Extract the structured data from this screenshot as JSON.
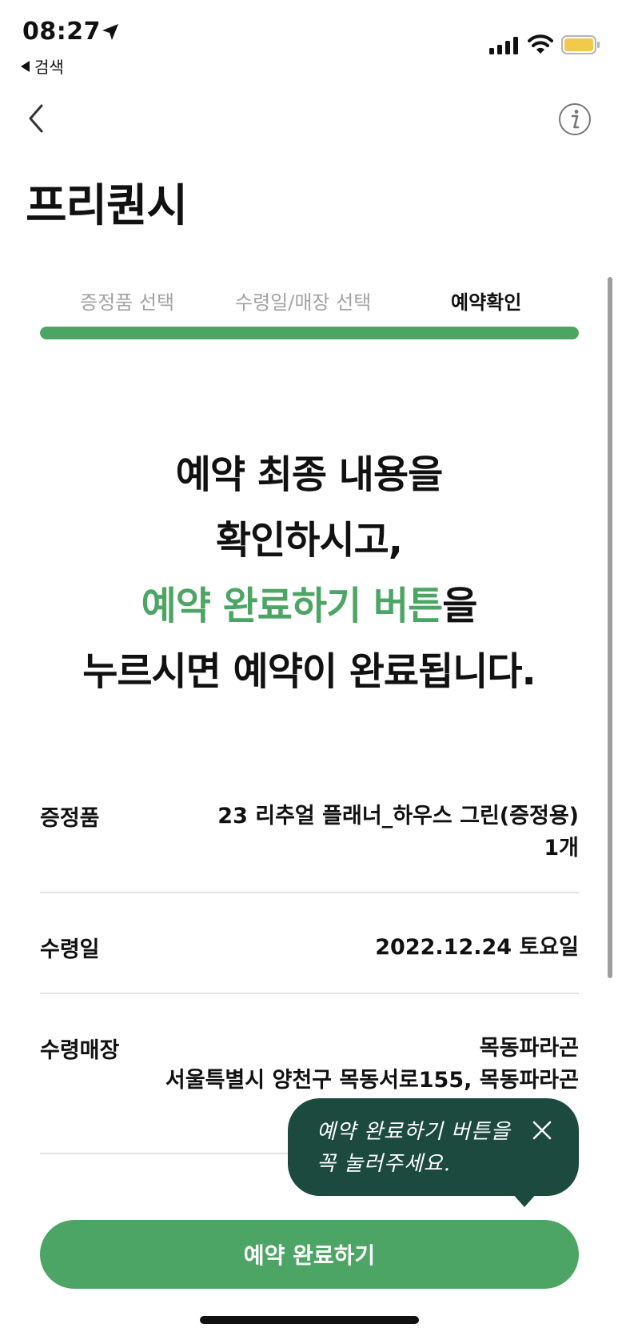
{
  "status_bar": {
    "time": "08:27",
    "back_app_label": "검색",
    "battery_color": "#f2c94c"
  },
  "header": {
    "title": "프리퀀시"
  },
  "steps": {
    "items": [
      {
        "label": "증정품 선택"
      },
      {
        "label": "수령일/매장 선택"
      },
      {
        "label": "예약확인"
      }
    ],
    "progress": 1.0,
    "accent_color": "#4ca564"
  },
  "headline": {
    "line1": "예약 최종 내용을",
    "line2": "확인하시고,",
    "line3_highlight": "예약 완료하기 버튼",
    "line3_rest": "을",
    "line4": "누르시면 예약이 완료됩니다."
  },
  "details": {
    "gift": {
      "label": "증정품",
      "value_line1": "23 리추얼 플래너_하우스 그린(증정용)",
      "value_line2": "1개"
    },
    "pickup_date": {
      "label": "수령일",
      "value": "2022.12.24 토요일"
    },
    "pickup_store": {
      "label": "수령매장",
      "value_line1": "목동파라곤",
      "value_line2": "서울특별시 양천구 목동서로155, 목동파라곤"
    }
  },
  "tooltip": {
    "line1": "예약 완료하기 버튼을",
    "line2": "꼭 눌러주세요.",
    "bg_color": "#1c4a3e"
  },
  "cta": {
    "label": "예약 완료하기"
  }
}
